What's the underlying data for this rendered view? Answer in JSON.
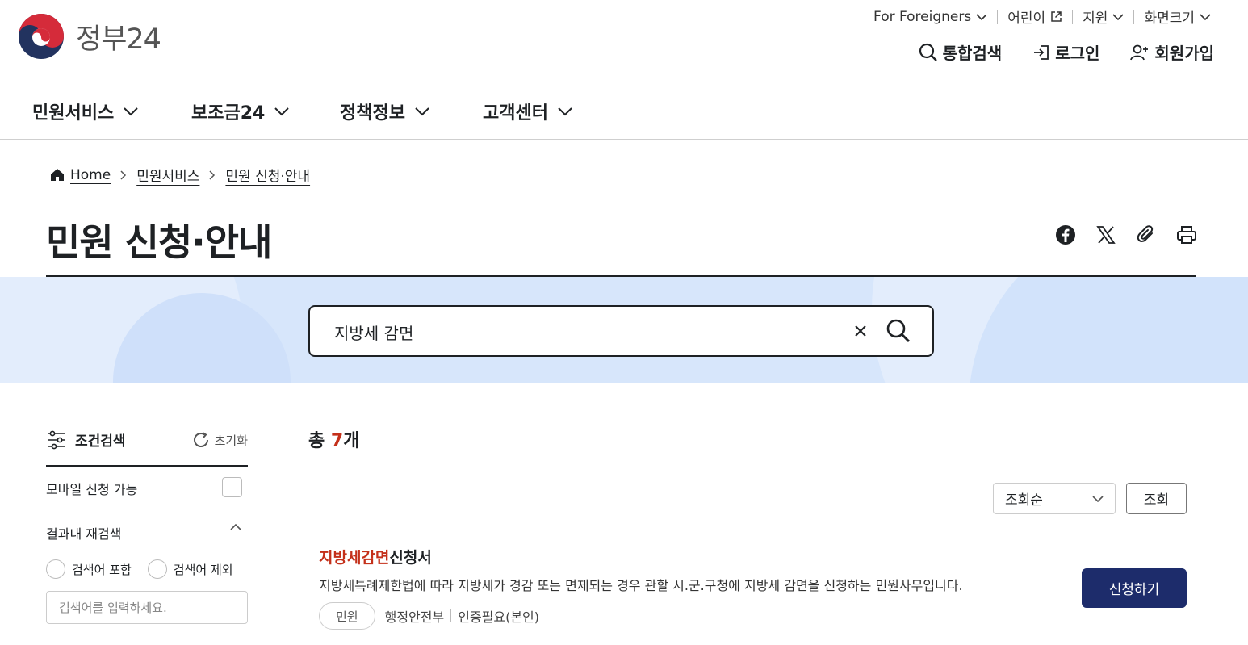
{
  "brand": {
    "name": "정부24"
  },
  "util_nav": {
    "foreigners": "For Foreigners",
    "kids": "어린이",
    "support": "지원",
    "font_size": "화면크기"
  },
  "auth_nav": {
    "search": "통합검색",
    "login": "로그인",
    "signup": "회원가입"
  },
  "gnb": {
    "items": [
      {
        "label": "민원서비스"
      },
      {
        "label": "보조금24"
      },
      {
        "label": "정책정보"
      },
      {
        "label": "고객센터"
      }
    ]
  },
  "breadcrumb": {
    "home": "Home",
    "level1": "민원서비스",
    "level2": "민원 신청·안내"
  },
  "page": {
    "title": "민원 신청·안내"
  },
  "share_icons": [
    "facebook-icon",
    "x-icon",
    "clip-icon",
    "print-icon"
  ],
  "search": {
    "value": "지방세 감면"
  },
  "filter": {
    "title": "조건검색",
    "reset": "초기화",
    "mobile_label": "모바일 신청 가능",
    "mobile_checked": false,
    "research_label": "결과내 재검색",
    "include_label": "검색어 포함",
    "exclude_label": "검색어 제외",
    "keyword_placeholder": "검색어를 입력하세요."
  },
  "results": {
    "total_prefix": "총",
    "total_count": "7",
    "total_suffix": "개",
    "sort_selected": "조회순",
    "query_button": "조회",
    "items": [
      {
        "title_highlight": "지방세감면",
        "title_rest": "신청서",
        "description": "지방세특례제한법에 따라 지방세가 경감 또는 면제되는 경우 관할 시.군.구청에 지방세 감면을 신청하는 민원사무입니다.",
        "chip": "민원",
        "agency": "행정안전부",
        "auth": "인증필요(본인)",
        "apply_label": "신청하기"
      }
    ]
  },
  "colors": {
    "accent_red": "#c4301a",
    "navy_button": "#1d2c6b",
    "band_blue": "#d7e6fb",
    "text": "#1e2124"
  }
}
